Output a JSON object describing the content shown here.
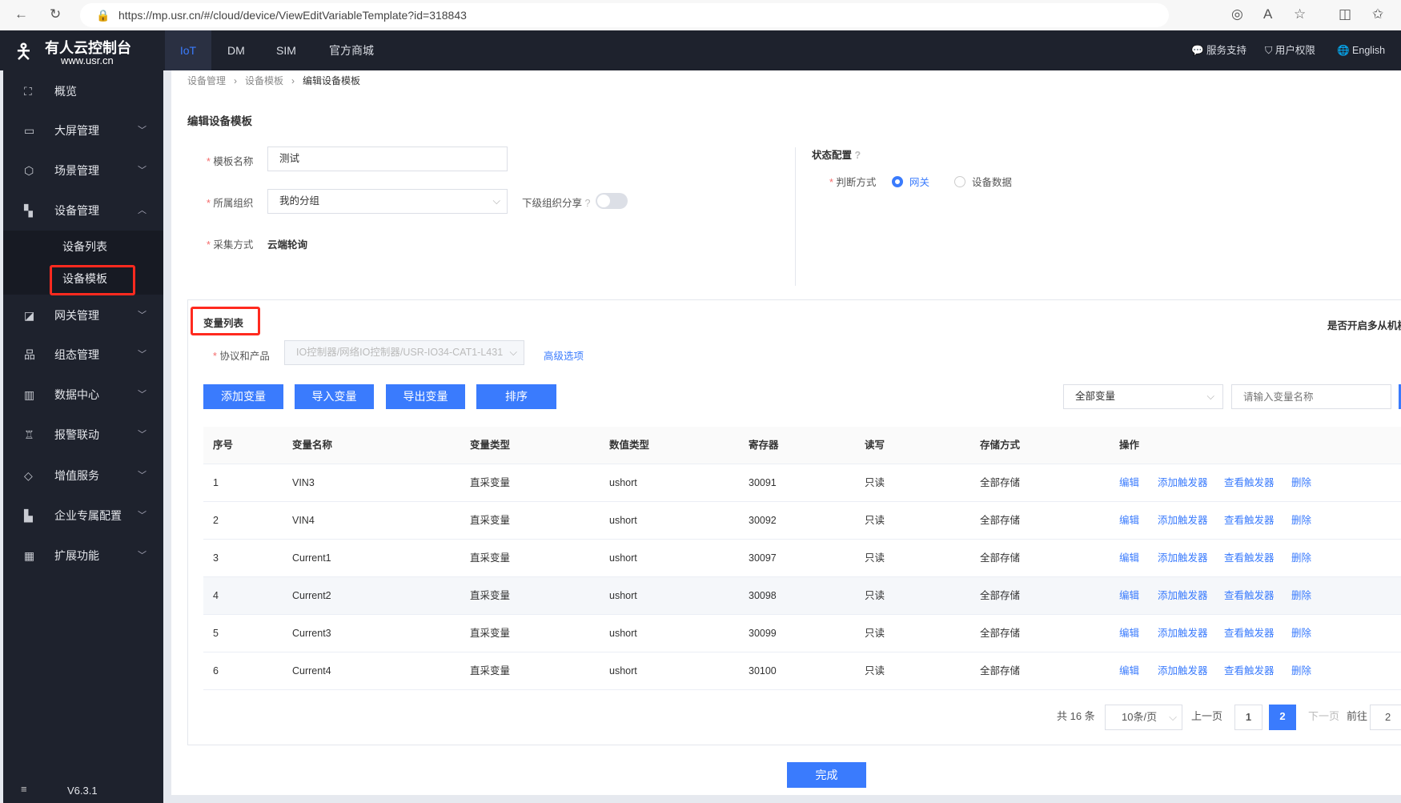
{
  "browser": {
    "url": "https://mp.usr.cn/#/cloud/device/ViewEditVariableTemplate?id=318843"
  },
  "header": {
    "logo_title": "有人云控制台",
    "logo_sub": "www.usr.cn",
    "tabs": [
      "IoT",
      "DM",
      "SIM",
      "官方商城"
    ],
    "active_tab": "IoT",
    "right": [
      "服务支持",
      "用户权限",
      "English"
    ]
  },
  "sidebar": {
    "items": [
      {
        "label": "概览",
        "icon": "overview-icon"
      },
      {
        "label": "大屏管理",
        "icon": "screen-icon"
      },
      {
        "label": "场景管理",
        "icon": "scene-icon"
      },
      {
        "label": "设备管理",
        "icon": "device-icon",
        "expanded": true,
        "children": [
          "设备列表",
          "设备模板"
        ],
        "active_child": "设备模板"
      },
      {
        "label": "网关管理",
        "icon": "gateway-icon"
      },
      {
        "label": "组态管理",
        "icon": "topology-icon"
      },
      {
        "label": "数据中心",
        "icon": "chart-icon"
      },
      {
        "label": "报警联动",
        "icon": "alarm-icon"
      },
      {
        "label": "增值服务",
        "icon": "diamond-icon"
      },
      {
        "label": "企业专属配置",
        "icon": "building-icon"
      },
      {
        "label": "扩展功能",
        "icon": "grid-icon"
      }
    ],
    "version": "V6.3.1"
  },
  "breadcrumb": [
    "设备管理",
    "设备模板",
    "编辑设备模板"
  ],
  "page_title": "编辑设备模板",
  "form": {
    "name_label": "模板名称",
    "name_value": "测试",
    "org_label": "所属组织",
    "org_value": "我的分组",
    "share_label": "下级组织分享",
    "share_on": false,
    "collect_label": "采集方式",
    "collect_value": "云端轮询"
  },
  "status": {
    "title": "状态配置",
    "judge_label": "判断方式",
    "options": [
      "网关",
      "设备数据"
    ],
    "selected": "网关"
  },
  "variables": {
    "title": "变量列表",
    "multi_slave_label": "是否开启多从机模",
    "protocol_label": "协议和产品",
    "protocol_value": "IO控制器/网络IO控制器/USR-IO34-CAT1-L431",
    "advanced": "高级选项",
    "buttons": [
      "添加变量",
      "导入变量",
      "导出变量",
      "排序"
    ],
    "filter_value": "全部变量",
    "search_placeholder": "请输入变量名称",
    "columns": [
      "序号",
      "变量名称",
      "变量类型",
      "数值类型",
      "寄存器",
      "读写",
      "存储方式",
      "操作"
    ],
    "rows": [
      [
        "1",
        "VIN3",
        "直采变量",
        "ushort",
        "30091",
        "只读",
        "全部存储"
      ],
      [
        "2",
        "VIN4",
        "直采变量",
        "ushort",
        "30092",
        "只读",
        "全部存储"
      ],
      [
        "3",
        "Current1",
        "直采变量",
        "ushort",
        "30097",
        "只读",
        "全部存储"
      ],
      [
        "4",
        "Current2",
        "直采变量",
        "ushort",
        "30098",
        "只读",
        "全部存储"
      ],
      [
        "5",
        "Current3",
        "直采变量",
        "ushort",
        "30099",
        "只读",
        "全部存储"
      ],
      [
        "6",
        "Current4",
        "直采变量",
        "ushort",
        "30100",
        "只读",
        "全部存储"
      ]
    ],
    "row_actions": [
      "编辑",
      "添加触发器",
      "查看触发器",
      "删除"
    ]
  },
  "pagination": {
    "total": "共 16 条",
    "page_size": "10条/页",
    "prev": "上一页",
    "pages": [
      "1",
      "2"
    ],
    "current": "2",
    "next": "下一页",
    "goto_label": "前往",
    "goto_value": "2"
  },
  "footer": {
    "done": "完成"
  },
  "colors": {
    "accent": "#3a7bfd",
    "nav_bg": "#1e222d",
    "highlight": "#ff2a1f"
  }
}
